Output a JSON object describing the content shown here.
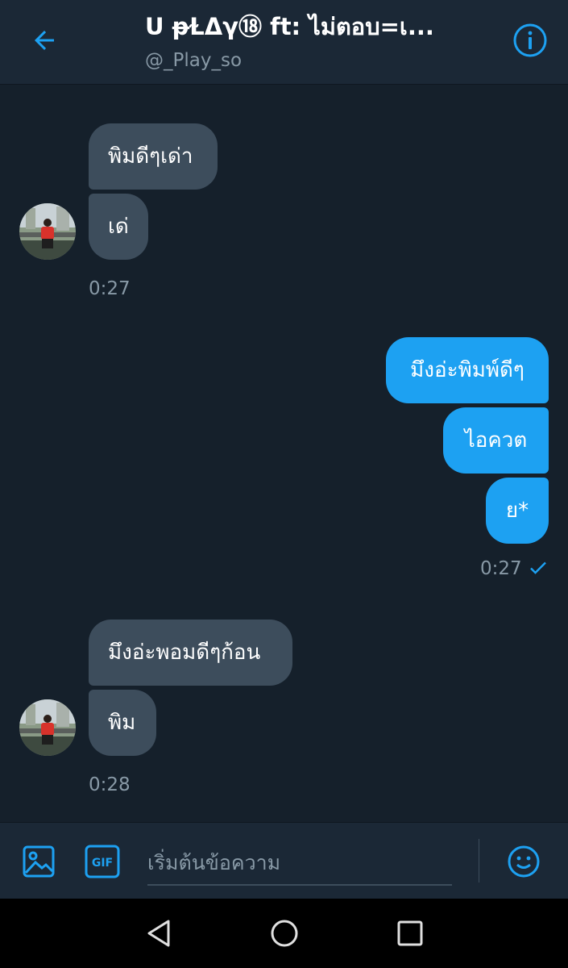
{
  "header": {
    "title": "ᑌ ᵽⱢΔγ⑱ ft: ไม่ตอบ=เ...",
    "username": "@_Play_so",
    "back_icon": "arrow-left-icon",
    "info_icon": "info-icon"
  },
  "colors": {
    "background": "#15202b",
    "header_bg": "#1b2836",
    "incoming_bubble": "#3d4d5c",
    "outgoing_bubble": "#1da1f2",
    "accent": "#1da1f2",
    "muted_text": "#8899a6"
  },
  "messages": {
    "group1": {
      "bubble1": "พิมดีๆเด่า",
      "bubble2": "เด่",
      "time": "0:27"
    },
    "group2": {
      "bubble1": "มึงอ่ะพิมพ์ดีๆ",
      "bubble2": "ไอควต",
      "bubble3": "ย*",
      "time": "0:27"
    },
    "group3": {
      "bubble1": "มึงอ่ะพอมดีๆก้อน",
      "bubble2": "พิม",
      "time": "0:28"
    }
  },
  "composer": {
    "placeholder": "เริ่มต้นข้อความ",
    "image_icon": "image-icon",
    "gif_label": "GIF",
    "emoji_icon": "emoji-icon"
  },
  "navbar": {
    "back": "nav-back-icon",
    "home": "nav-home-icon",
    "recents": "nav-recents-icon"
  }
}
